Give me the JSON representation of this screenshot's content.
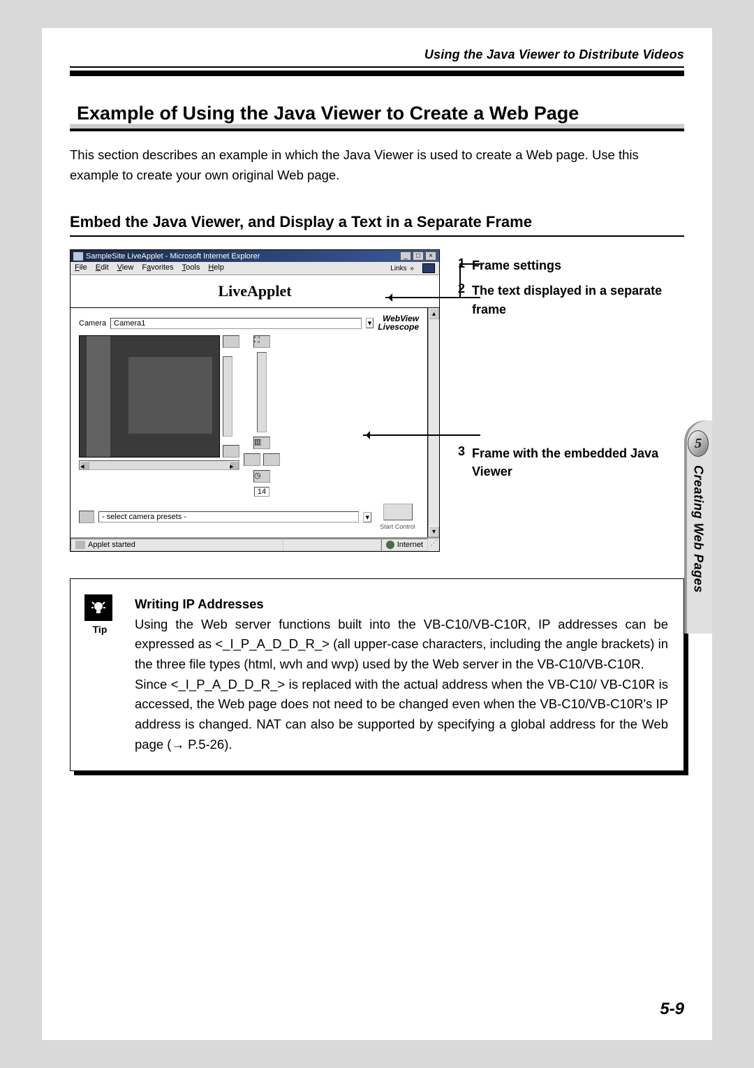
{
  "header": {
    "running": "Using the Java Viewer to Distribute Videos"
  },
  "title": "Example of Using the Java Viewer to Create a Web Page",
  "intro": "This section describes an example in which the Java Viewer is used to create a Web page. Use this example to create your own original Web page.",
  "subtitle": "Embed the Java Viewer, and Display a Text in a Separate Frame",
  "window": {
    "title": "SampleSite LiveApplet - Microsoft Internet Explorer",
    "menus": [
      "File",
      "Edit",
      "View",
      "Favorites",
      "Tools",
      "Help"
    ],
    "links_label": "Links",
    "applet_title": "LiveApplet",
    "camera_label": "Camera",
    "camera_value": "Camera1",
    "webview": "WebView",
    "livescope": "Livescope",
    "connections": "14",
    "start_label": "Start Control",
    "preset": "- select camera presets -",
    "status_left": "Applet started",
    "status_right": "Internet"
  },
  "legend": {
    "i1": {
      "n": "1",
      "t": "Frame settings"
    },
    "i2": {
      "n": "2",
      "t": "The text displayed in a separate frame"
    },
    "i3": {
      "n": "3",
      "t": "Frame with the embedded Java Viewer"
    }
  },
  "tip": {
    "icon_label": "Tip",
    "title": "Writing IP Addresses",
    "body1": "Using the Web server functions built into the VB-C10/VB-C10R, IP addresses can be expressed as <_I_P_A_D_D_R_> (all upper-case characters, including the angle brackets) in the three file types (html, wvh and wvp) used by the Web server in the VB-C10/VB-C10R.",
    "body2": "Since <_I_P_A_D_D_R_> is replaced with the actual address when the VB-C10/ VB-C10R is accessed, the Web page does not need to be changed even when the VB-C10/VB-C10R's IP address is changed. NAT can also be supported by specifying a global address for the Web page (→ P.5-26)."
  },
  "sidetab": {
    "num": "5",
    "label": "Creating Web Pages"
  },
  "pagenum": "5-9"
}
